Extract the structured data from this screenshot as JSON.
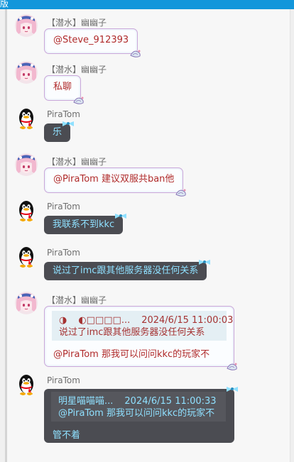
{
  "window": {
    "title_fragment": "版"
  },
  "messages": [
    {
      "kind": "girl",
      "sender": "【潜水】幽幽子",
      "text": "@Steve_912393"
    },
    {
      "kind": "girl",
      "sender": "【潜水】幽幽子",
      "text": "私聊"
    },
    {
      "kind": "dark",
      "sender": "PiraTom",
      "text": "乐"
    },
    {
      "kind": "girl",
      "sender": "【潜水】幽幽子",
      "text": "@PiraTom 建议双服共ban他"
    },
    {
      "kind": "dark",
      "sender": "PiraTom",
      "text": "我联系不到kkc"
    },
    {
      "kind": "dark",
      "sender": "PiraTom",
      "text": "说过了imc跟其他服务器没任何关系"
    },
    {
      "kind": "girl",
      "sender": "【潜水】幽幽子",
      "quote": {
        "icon": "◑",
        "author": "◐□□□□...",
        "time": "2024/6/15 11:00:03",
        "text": "说过了imc跟其他服务器没任何关系"
      },
      "text": "@PiraTom 那我可以问问kkc的玩家不"
    },
    {
      "kind": "dark",
      "sender": "PiraTom",
      "quote": {
        "author": "明星喵喵喵...",
        "time": "2024/6/15 11:00:33",
        "text": "@PiraTom 那我可以问问kkc的玩家不"
      },
      "text": "管不着"
    }
  ]
}
